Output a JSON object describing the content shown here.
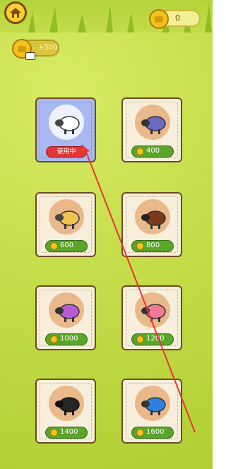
{
  "header": {
    "home_icon": "home-icon",
    "coins": "0",
    "video_reward": "+500"
  },
  "skins": [
    {
      "name": "white",
      "selected": true,
      "status": "使用中",
      "color": "#ffffff"
    },
    {
      "name": "purple-blue",
      "price": "400",
      "color": "#6a6bbf"
    },
    {
      "name": "yellow",
      "price": "600",
      "color": "#f0c24f"
    },
    {
      "name": "brown",
      "price": "800",
      "color": "#7a3a1a"
    },
    {
      "name": "purple",
      "price": "1000",
      "color": "#b85ad4"
    },
    {
      "name": "pink",
      "price": "1200",
      "color": "#f07a98"
    },
    {
      "name": "black",
      "price": "1400",
      "color": "#262626"
    },
    {
      "name": "blue",
      "price": "1600",
      "color": "#2f80e0"
    }
  ]
}
